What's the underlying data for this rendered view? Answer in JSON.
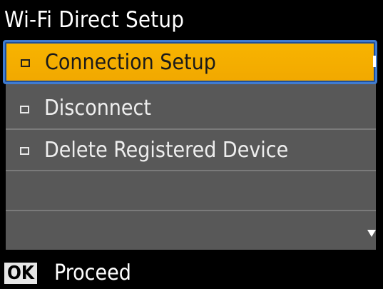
{
  "header": {
    "title": "Wi-Fi Direct Setup"
  },
  "menu": {
    "items": [
      {
        "label": "Connection Setup",
        "selected": true
      },
      {
        "label": "Disconnect"
      },
      {
        "label": "Delete Registered Device"
      },
      {
        "label": ""
      },
      {
        "label": ""
      }
    ]
  },
  "footer": {
    "ok_key": "OK",
    "action_label": "Proceed"
  },
  "colors": {
    "selected_fill": "#f5ae00",
    "selected_border": "#3f7bd0",
    "row_fill": "#585858",
    "background": "#000000"
  },
  "icons": {
    "bullet": "square-bullet-icon",
    "scroll_down": "scroll-down-arrow-icon",
    "scroll_up": "scroll-up-indicator-icon"
  }
}
